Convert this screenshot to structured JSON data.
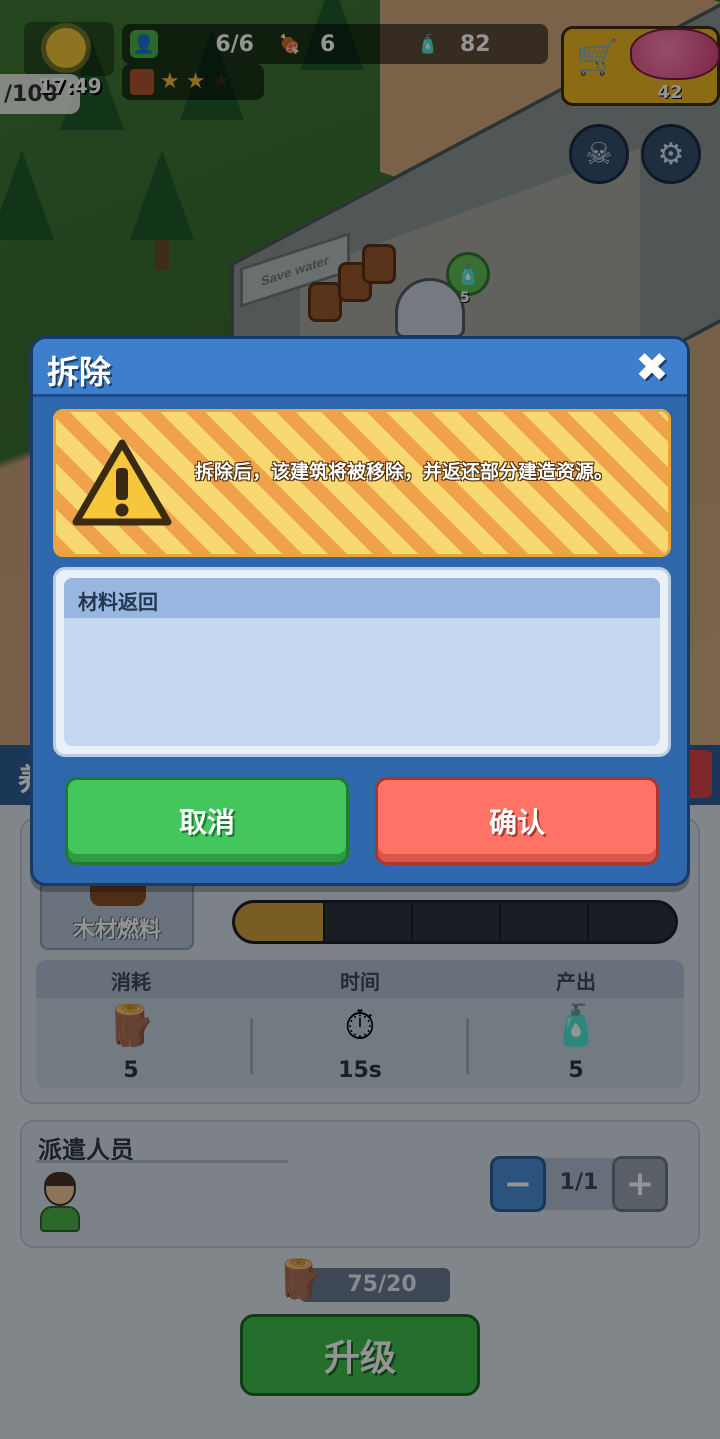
{
  "hud": {
    "left_count": "/100",
    "time": "17:49",
    "population": "6/6",
    "food": "6",
    "water": "82",
    "gems": "42",
    "rank_stars": 2,
    "rank_stars_max": 3,
    "icons": {
      "weather": "sun-icon",
      "population": "person-icon",
      "food": "meat-icon",
      "water": "water-bottle-icon",
      "shop": "cart-icon",
      "gem": "gem-icon",
      "codex": "skull-book-icon",
      "settings": "gear-icon"
    }
  },
  "world": {
    "sign_text": "Save water",
    "bubble_count": "5"
  },
  "dialog": {
    "title": "拆除",
    "close_glyph": "✖",
    "warning": "拆除后，该建筑将被移除，并返还部分建造资源。",
    "materials_header": "材料返回",
    "cancel_label": "取消",
    "confirm_label": "确认"
  },
  "panel": {
    "title_partial": "养",
    "fuel_label": "木材燃料",
    "progress": 0.2,
    "stats": [
      {
        "label": "消耗",
        "icon": "log-icon",
        "value": "5"
      },
      {
        "label": "时间",
        "icon": "stopwatch-icon",
        "value": "15s"
      },
      {
        "label": "产出",
        "icon": "water-bottle-icon",
        "value": "5"
      }
    ],
    "staff_title": "派遣人员",
    "staff_count": "1/1",
    "cost": "75/20",
    "upgrade_label": "升级"
  },
  "colors": {
    "dialog_bg": "#2f67ad",
    "cancel": "#43c75c",
    "confirm": "#ff7266",
    "warning_stripe_a": "#f0a24a",
    "warning_stripe_b": "#f8d870"
  }
}
